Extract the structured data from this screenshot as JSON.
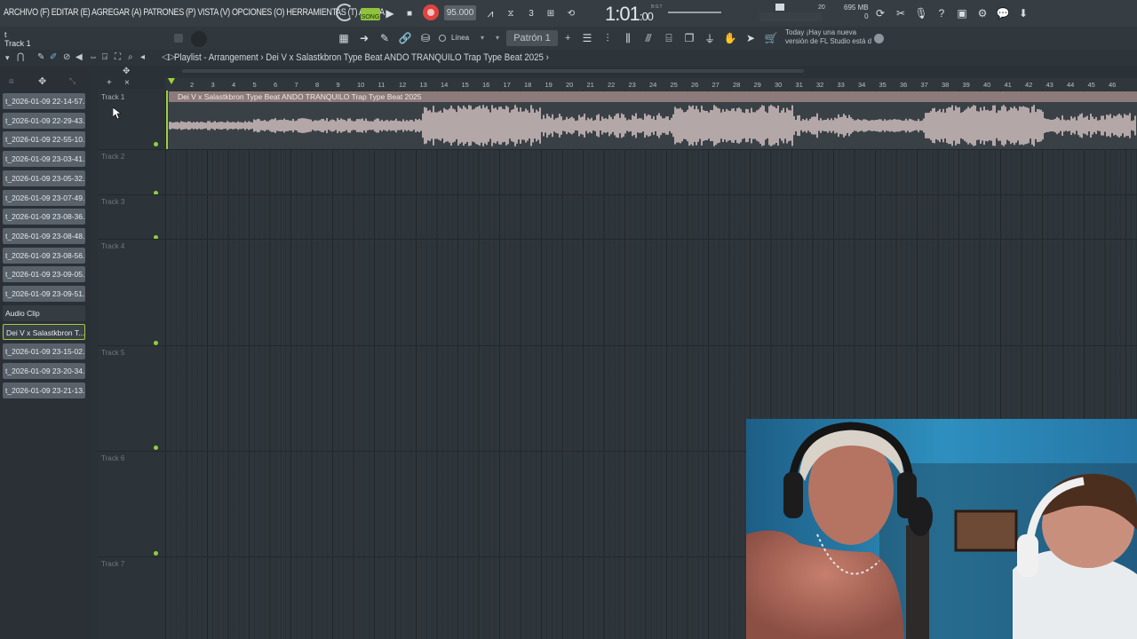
{
  "menu": {
    "items": [
      "ARCHIVO (F)",
      "EDITAR (E)",
      "AGREGAR (A)",
      "PATRONES (P)",
      "VISTA (V)",
      "OPCIONES (O)",
      "HERRAMIENTAS (T)",
      "AYUDA"
    ]
  },
  "hint": {
    "line1": "t",
    "line2": "Track 1"
  },
  "transport": {
    "song_label": "SONG",
    "bpm": "95.000",
    "time": "1:01",
    "time_small": ":00",
    "time_unit": "B:S:T",
    "cpu": "20",
    "memory": "695 MB",
    "memory_sub": "0"
  },
  "toolbar": {
    "snap_mode": "Línea",
    "pattern": "Patrón 1",
    "news_line1": "Today  ¡Hay una nueva",
    "news_line2": "versión de FL Studio está d"
  },
  "playlist": {
    "title": "Playlist - Arrangement › Dei V x Salastkbron Type Beat  ANDO TRANQUILO  Trap Type Beat 2025 ›"
  },
  "clips": [
    "t_2026-01-09 22-14-57...",
    "t_2026-01-09 22-29-43...",
    "t_2026-01-09 22-55-10...",
    "t_2026-01-09 23-03-41...",
    "t_2026-01-09 23-05-32...",
    "t_2026-01-09 23-07-49...",
    "t_2026-01-09 23-08-36...",
    "t_2026-01-09 23-08-48...",
    "t_2026-01-09 23-08-56...",
    "t_2026-01-09 23-09-05...",
    "t_2026-01-09 23-09-51...",
    "Audio Clip",
    "Dei V x Salastkbron T...",
    "t_2026-01-09 23-15-02...",
    "t_2026-01-09 23-20-34...",
    "t_2026-01-09 23-21-13..."
  ],
  "tracks": [
    "Track 1",
    "Track 2",
    "Track 3",
    "Track 4",
    "Track 5",
    "Track 6",
    "Track 7"
  ],
  "ruler": [
    "2",
    "3",
    "4",
    "5",
    "6",
    "7",
    "8",
    "9",
    "10",
    "11",
    "12",
    "13",
    "14",
    "15",
    "16",
    "17",
    "18",
    "19",
    "20",
    "21",
    "22",
    "23",
    "24",
    "25",
    "26",
    "27",
    "28",
    "29",
    "30",
    "31",
    "32",
    "33",
    "34",
    "35",
    "36",
    "37",
    "38",
    "39",
    "40",
    "41",
    "42",
    "43",
    "44",
    "45",
    "46"
  ],
  "audio_clip": {
    "name": "Dei V x Salastkbron Type Beat  ANDO TRANQUILO  Trap Type Beat 2025"
  },
  "colors": {
    "accent": "#8fd03a",
    "record": "#e0433f",
    "clip": "#8c7b7a",
    "wave": "#e8d3d1"
  }
}
